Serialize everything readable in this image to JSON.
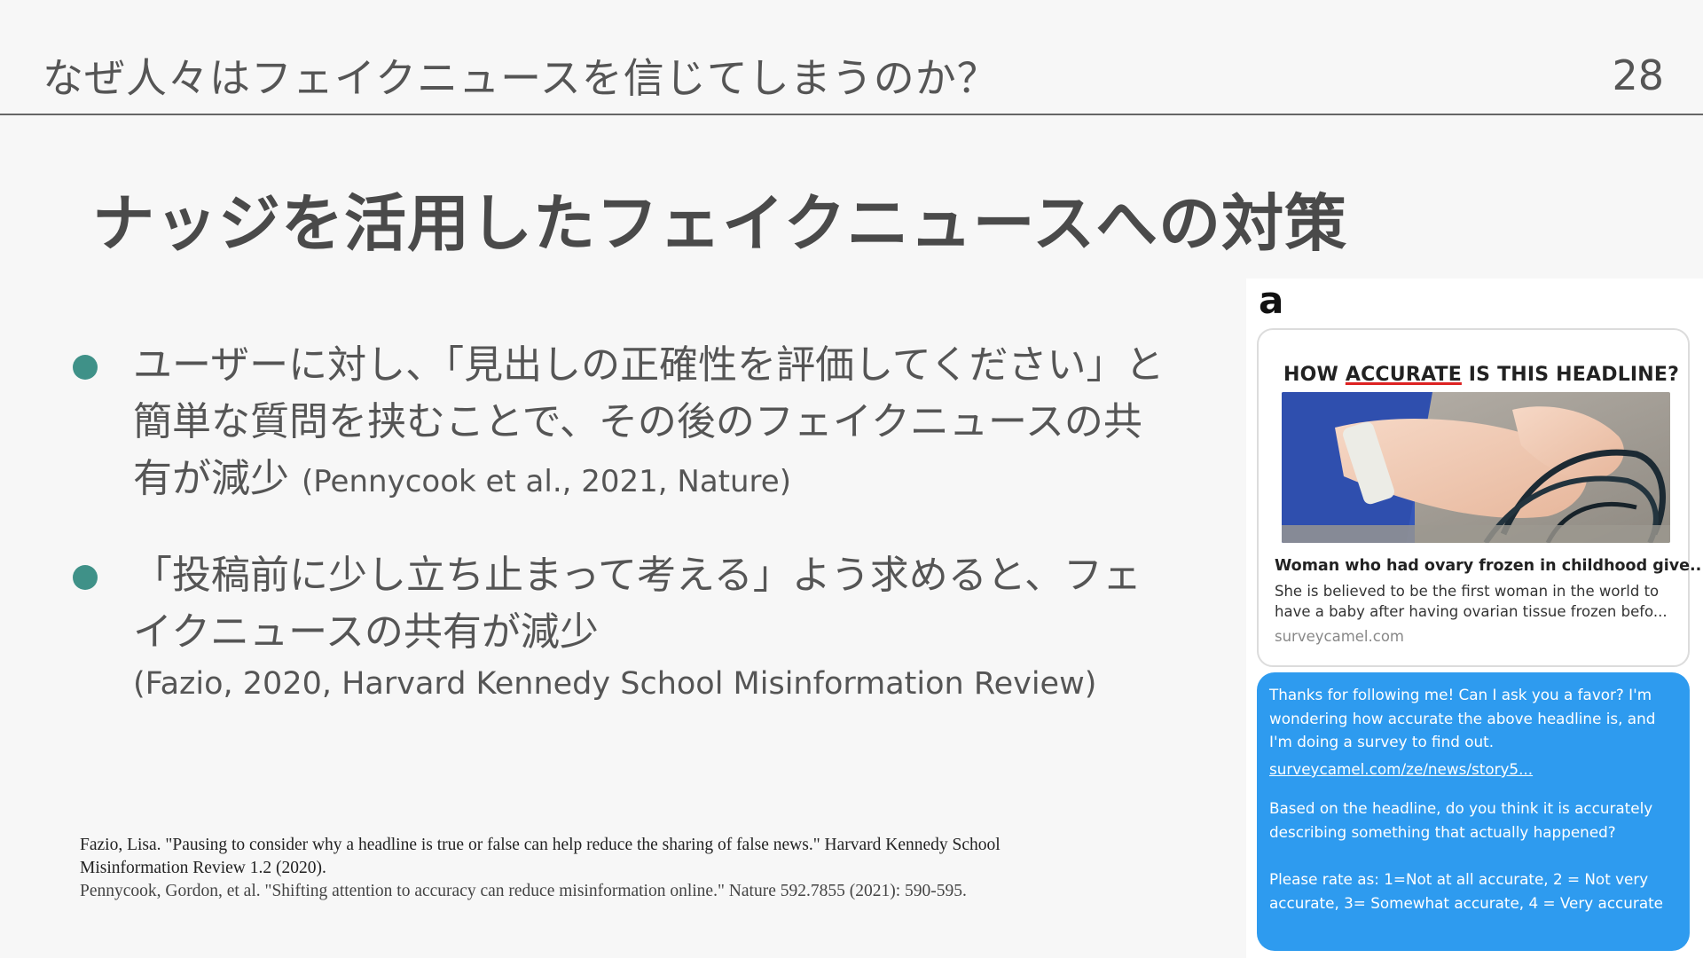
{
  "header": {
    "title": "なぜ人々はフェイクニュースを信じてしまうのか？",
    "page_number": "28"
  },
  "slide": {
    "title": "ナッジを活用したフェイクニュースへの対策"
  },
  "bullets": [
    {
      "text": "ユーザーに対し、「見出しの正確性を評価してください」と簡単な質問を挟むことで、その後のフェイクニュースの共有が減少",
      "citation": "(Pennycook et al., 2021, Nature)"
    },
    {
      "text": "「投稿前に少し立ち止まって考える」よう求めると、フェイクニュースの共有が減少",
      "citation": "(Fazio, 2020, Harvard Kennedy School Misinformation Review)"
    }
  ],
  "references": [
    "Fazio, Lisa. \"Pausing to consider why a headline is true or false can help reduce the sharing of false news.\" Harvard Kennedy School Misinformation Review 1.2 (2020).",
    "Pennycook, Gordon, et al. \"Shifting attention to accuracy can reduce misinformation online.\" Nature 592.7855 (2021): 590-595."
  ],
  "figure": {
    "label": "a",
    "card": {
      "question_before": "HOW ",
      "question_underlined": "ACCURATE",
      "question_after": " IS THIS HEADLINE?",
      "headline": "Woman who had ovary frozen in childhood give...",
      "description": "She is believed to be the first woman in the world to have a baby after having ovarian tissue frozen befo...",
      "domain": "surveycamel.com"
    },
    "message": {
      "intro": "Thanks for following me! Can I ask you a favor? I'm wondering how accurate the above headline is, and I'm doing a survey to find out.",
      "link": "surveycamel.com/ze/news/story5...",
      "question": "Based on the headline, do you think it is accurately describing something that actually happened?",
      "scale": "Please rate as: 1=Not at all accurate, 2 = Not very accurate, 3= Somewhat accurate, 4 = Very accurate"
    },
    "colors": {
      "bubble": "#2e9bef",
      "bullet": "#3f9188",
      "underline": "#dd2222"
    }
  }
}
